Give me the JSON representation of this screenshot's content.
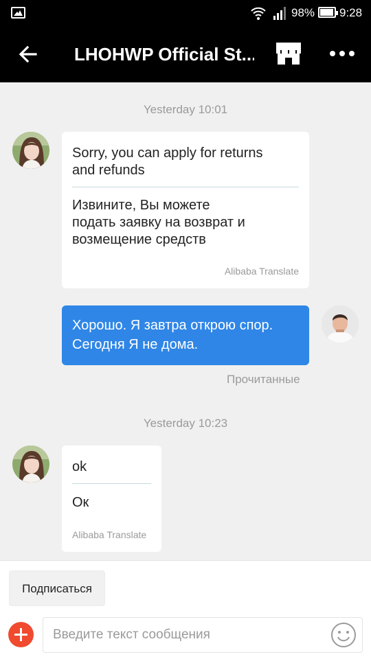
{
  "status_bar": {
    "battery": "98%",
    "time": "9:28"
  },
  "header": {
    "title": "LHOHWP Official St..."
  },
  "chat": {
    "ts1": "Yesterday 10:01",
    "msg1": {
      "original_1": "Sorry, you can apply for returns",
      "original_2": "and refunds",
      "translated_1": "Извините, Вы можете",
      "translated_2": "подать заявку на возврат и",
      "translated_3": "возмещение средств",
      "tag": "Alibaba Translate"
    },
    "msg2": {
      "line_1": "Хорошо. Я завтра открою спор.",
      "line_2": "Сегодня Я не дома.",
      "status": "Прочитанные"
    },
    "ts2": "Yesterday 10:23",
    "msg3": {
      "original": "ok",
      "translated": "Ок",
      "tag": "Alibaba Translate"
    }
  },
  "bottom": {
    "subscribe_label": "Подписаться",
    "input_placeholder": "Введите текст сообщения"
  },
  "colors": {
    "accent_bubble": "#2f86e6",
    "plus_button": "#f04a2f",
    "header_bg": "#000000"
  },
  "icons": [
    "gallery-icon",
    "wifi-icon",
    "signal-icon",
    "battery-icon",
    "back-arrow-icon",
    "store-icon",
    "more-icon",
    "plus-icon",
    "emoji-icon"
  ]
}
